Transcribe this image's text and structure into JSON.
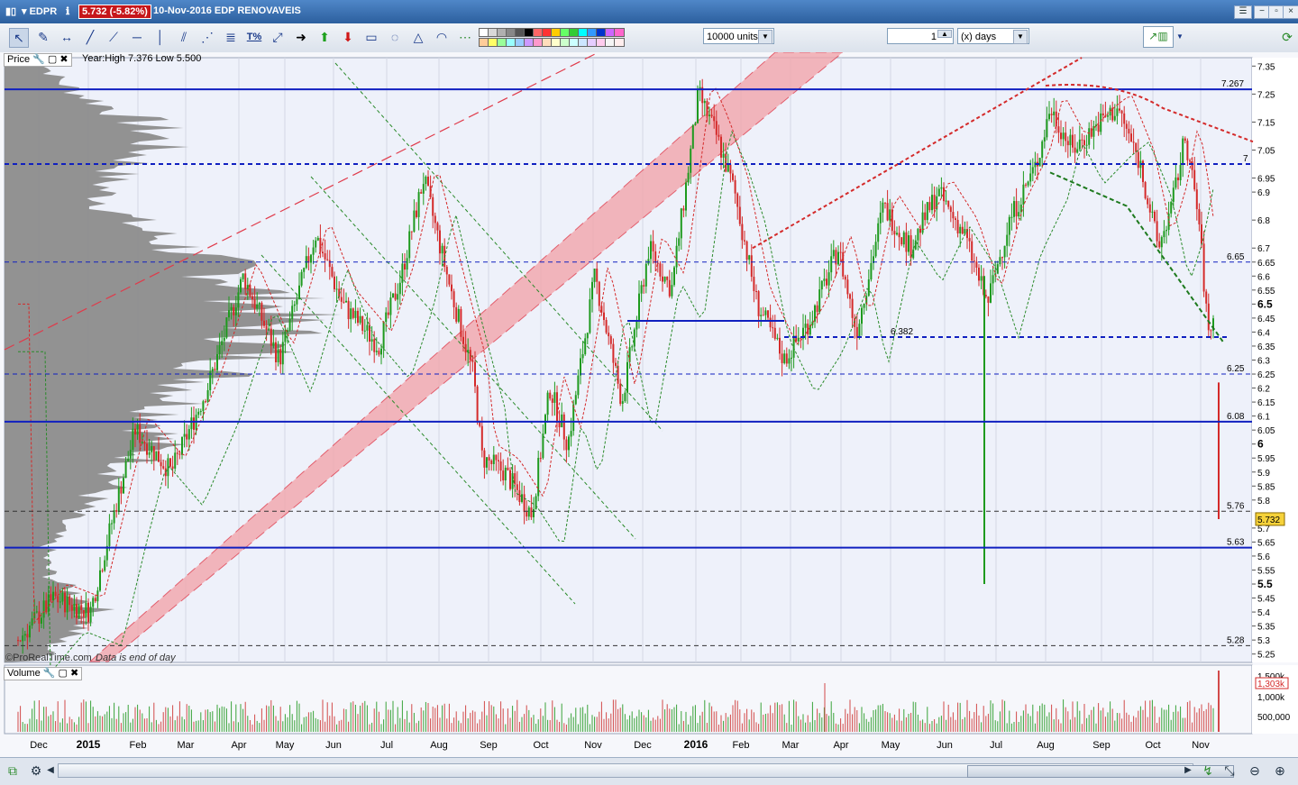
{
  "window": {
    "symbol": "EDPR",
    "price_change": "5.732 (-5.82%)",
    "title": "10-Nov-2016 EDP RENOVAVEIS"
  },
  "toolbar": {
    "units": "10000 units",
    "period_value": "1",
    "period_unit": "(x) days",
    "percent_tool": "T%",
    "colors": [
      "#ffffff",
      "#d8d8d8",
      "#b0b0b0",
      "#888888",
      "#555555",
      "#000000",
      "#ff6666",
      "#ff3333",
      "#ffcc00",
      "#66ff66",
      "#33cc33",
      "#00ffff",
      "#3399ff",
      "#0033cc",
      "#cc66ff",
      "#ff66cc",
      "#ffcc99",
      "#ffff66",
      "#99ff99",
      "#99ffff",
      "#99ccff",
      "#cc99ff",
      "#ff99cc",
      "#ffddbb",
      "#ffffcc",
      "#ccffcc",
      "#ccffff",
      "#cce5ff",
      "#e5ccff",
      "#ffccee",
      "#f5f5f5",
      "#ffeeee"
    ]
  },
  "price_panel": {
    "legend_label": "Price",
    "info": "Year:High 7.376 Low 5.500",
    "watermark": "©ProRealTime.com",
    "eod_note": "Data is end of day",
    "last_price": "5.732"
  },
  "volume_panel": {
    "legend_label": "Volume",
    "last_volume": "1,303k",
    "axis_labels": [
      "1,500k",
      "1,000k",
      "500,000"
    ]
  },
  "chart_data": {
    "type": "candlestick",
    "x_axis_labels": [
      "Dec",
      "2015",
      "Feb",
      "Mar",
      "Apr",
      "May",
      "Jun",
      "Jul",
      "Aug",
      "Sep",
      "Oct",
      "Nov",
      "Dec",
      "2016",
      "Feb",
      "Mar",
      "Apr",
      "May",
      "Jun",
      "Jul",
      "Aug",
      "Sep",
      "Oct",
      "Nov"
    ],
    "y_axis_ticks": [
      "7.35",
      "7.25",
      "7.15",
      "7.05",
      "6.95",
      "6.9",
      "6.8",
      "6.7",
      "6.65",
      "6.6",
      "6.55",
      "6.5",
      "6.45",
      "6.4",
      "6.35",
      "6.3",
      "6.25",
      "6.2",
      "6.15",
      "6.1",
      "6.05",
      "6",
      "5.95",
      "5.9",
      "5.85",
      "5.8",
      "5.7",
      "5.65",
      "5.6",
      "5.55",
      "5.5",
      "5.45",
      "5.4",
      "5.35",
      "5.3",
      "5.25"
    ],
    "ylim": [
      5.22,
      7.38
    ],
    "grid": true,
    "horizontal_levels": [
      {
        "label": "7.267",
        "value": 7.267,
        "style": "solid"
      },
      {
        "label": "7",
        "value": 7.0,
        "style": "dashed"
      },
      {
        "label": "6.65",
        "value": 6.65,
        "style": "dashed"
      },
      {
        "label": "6.382",
        "value": 6.382,
        "style": "dashed"
      },
      {
        "label": "6.25",
        "value": 6.25,
        "style": "dashed"
      },
      {
        "label": "6.08",
        "value": 6.08,
        "style": "solid"
      },
      {
        "label": "5.76",
        "value": 5.76,
        "style": "dashed"
      },
      {
        "label": "5.63",
        "value": 5.63,
        "style": "solid"
      },
      {
        "label": "5.28",
        "value": 5.28,
        "style": "dashed"
      }
    ],
    "year_high": 7.376,
    "year_low": 5.5,
    "last": 5.732
  }
}
